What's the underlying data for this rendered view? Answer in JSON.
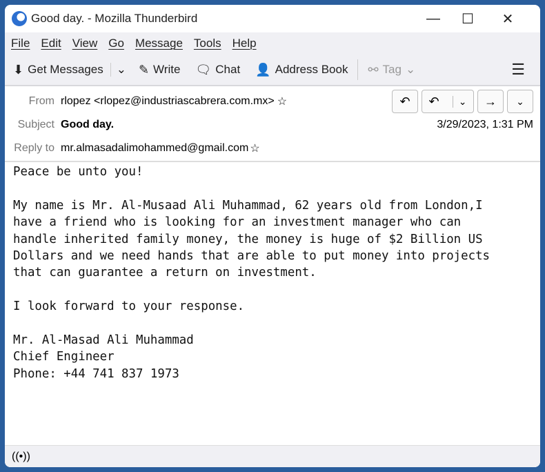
{
  "window": {
    "title": "Good day. - Mozilla Thunderbird"
  },
  "menu": [
    "File",
    "Edit",
    "View",
    "Go",
    "Message",
    "Tools",
    "Help"
  ],
  "toolbar": {
    "get_messages": "Get Messages",
    "write": "Write",
    "chat": "Chat",
    "address_book": "Address Book",
    "tag": "Tag"
  },
  "header": {
    "from_label": "From",
    "from": "rlopez <rlopez@industriascabrera.com.mx>",
    "subject_label": "Subject",
    "subject": "Good day.",
    "date": "3/29/2023, 1:31 PM",
    "reply_to_label": "Reply to",
    "reply_to": "mr.almasadalimohammed@gmail.com"
  },
  "body": {
    "text": "Peace be unto you!\n\nMy name is Mr. Al-Musaad Ali Muhammad, 62 years old from London,I\nhave a friend who is looking for an investment manager who can\nhandle inherited family money, the money is huge of $2 Billion US\nDollars and we need hands that are able to put money into projects\nthat can guarantee a return on investment.\n\nI look forward to your response.\n\nMr. Al-Masad Ali Muhammad\nChief Engineer\nPhone: +44 741 837 1973"
  }
}
